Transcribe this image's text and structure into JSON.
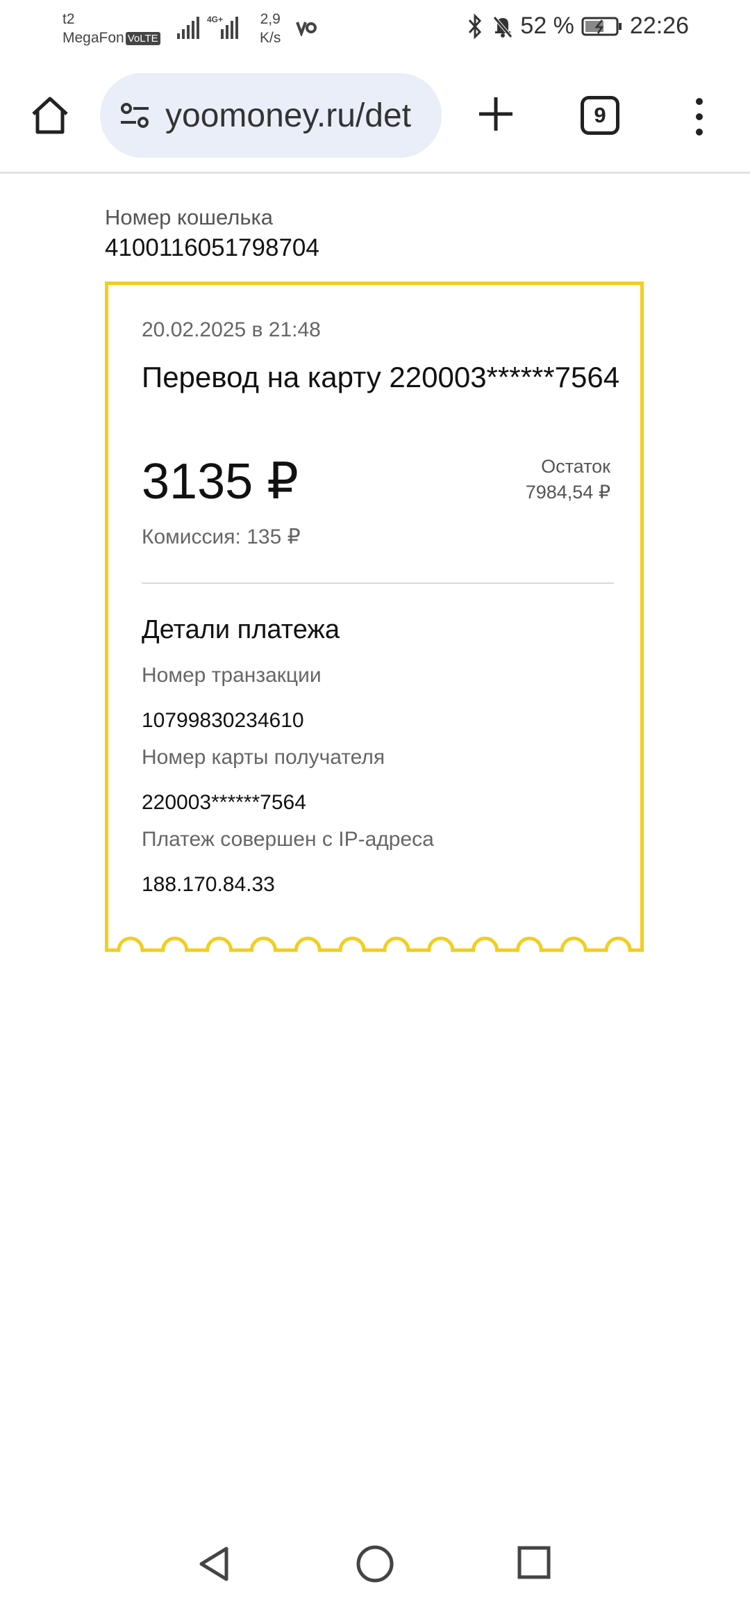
{
  "status_bar": {
    "carrier_1": "t2",
    "carrier_2": "MegaFon",
    "volte": "VoLTE",
    "network": "4G+",
    "speed_value": "2,9",
    "speed_unit": "K/s",
    "battery_percent": "52 %",
    "time": "22:26"
  },
  "browser": {
    "url": "yoomoney.ru/det",
    "tab_count": "9"
  },
  "wallet": {
    "label": "Номер кошелька",
    "number": "4100116051798704"
  },
  "receipt": {
    "date": "20.02.2025 в 21:48",
    "title": "Перевод на карту 220003******7564",
    "amount": "3135 ₽",
    "balance_label": "Остаток",
    "balance_value": "7984,54 ₽",
    "fee": "Комиссия: 135 ₽",
    "details_title": "Детали платежа",
    "fields": [
      {
        "label": "Номер транзакции",
        "value": "10799830234610"
      },
      {
        "label": "Номер карты получателя",
        "value": "220003******7564"
      },
      {
        "label": "Платеж совершен с IP-адреса",
        "value": "188.170.84.33"
      }
    ]
  },
  "colors": {
    "accent_border": "#f2ce1d",
    "url_bar_bg": "#e9eef8"
  }
}
